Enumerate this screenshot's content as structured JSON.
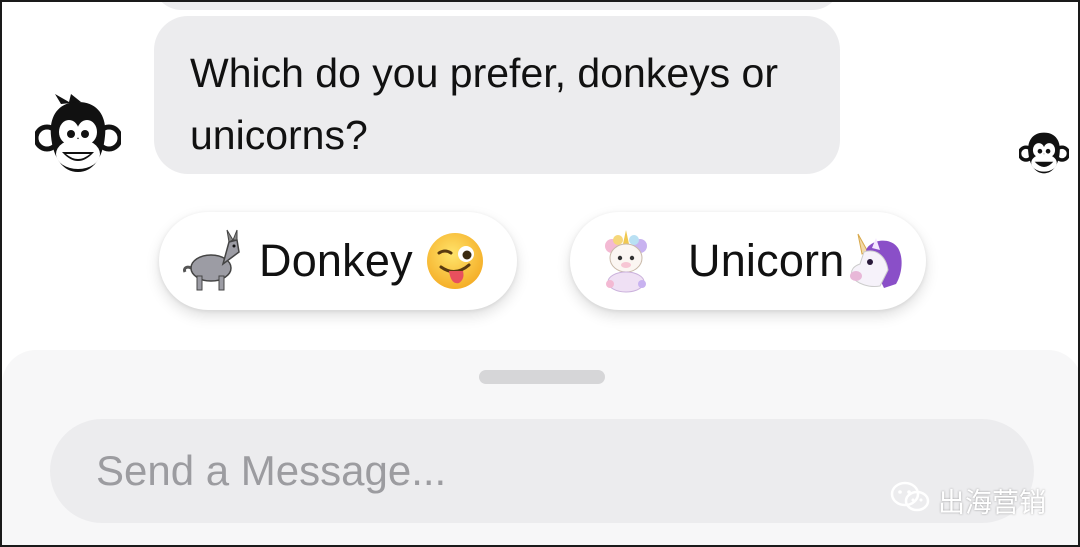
{
  "chat": {
    "bot_message": "Which do you prefer, donkeys or unicorns?",
    "quick_replies": [
      {
        "label": "Donkey",
        "picture": "donkey-picture",
        "emoji": "winking-tongue-face-emoji"
      },
      {
        "label": "Unicorn",
        "picture": "unicorn-picture",
        "emoji": "unicorn-emoji"
      }
    ]
  },
  "composer": {
    "placeholder": "Send a Message..."
  },
  "watermark": {
    "text": "出海营销",
    "icon": "wechat-icon"
  },
  "colors": {
    "bubble": "#ececee",
    "input": "#ececee",
    "placeholder": "#9c9ca0",
    "unicorn_mane": "#8a4fc8"
  }
}
